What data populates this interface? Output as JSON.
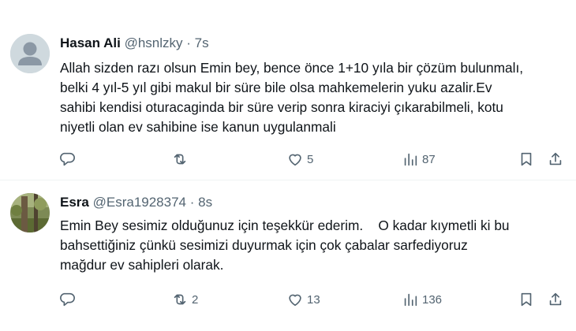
{
  "tweets": [
    {
      "name": "Hasan Ali",
      "handle": "@hsnlzky",
      "separator": "·",
      "time": "7s",
      "lines": [
        "Allah sizden razı olsun Emin bey, bence önce 1+10 yıla bir çözüm bulunmalı,",
        "belki 4 yıl-5 yıl gibi makul bir süre bile olsa mahkemelerin yuku azalir.Ev",
        "sahibi kendisi oturacaginda bir süre verip sonra kiraciyi çıkarabilmeli, kotu",
        "niyetli olan ev sahibine ise kanun uygulanmali"
      ],
      "replies": "",
      "reposts": "",
      "likes": "5",
      "views": "87"
    },
    {
      "name": "Esra",
      "handle": "@Esra1928374",
      "separator": "·",
      "time": "8s",
      "lines": [
        "Emin Bey sesimiz olduğunuz için teşekkür ederim.    O kadar kıymetli ki bu",
        "bahsettiğiniz çünkü sesimizi duyurmak için çok çabalar sarfediyoruz",
        "mağdur ev sahipleri olarak."
      ],
      "replies": "",
      "reposts": "2",
      "likes": "13",
      "views": "136"
    }
  ],
  "colors": {
    "text": "#0f1419",
    "secondary": "#536471",
    "divider": "#eff3f4",
    "avatar_default_bg": "#cfd9de"
  },
  "icons": [
    "reply-icon",
    "repost-icon",
    "like-icon",
    "views-icon",
    "bookmark-icon",
    "share-icon"
  ]
}
